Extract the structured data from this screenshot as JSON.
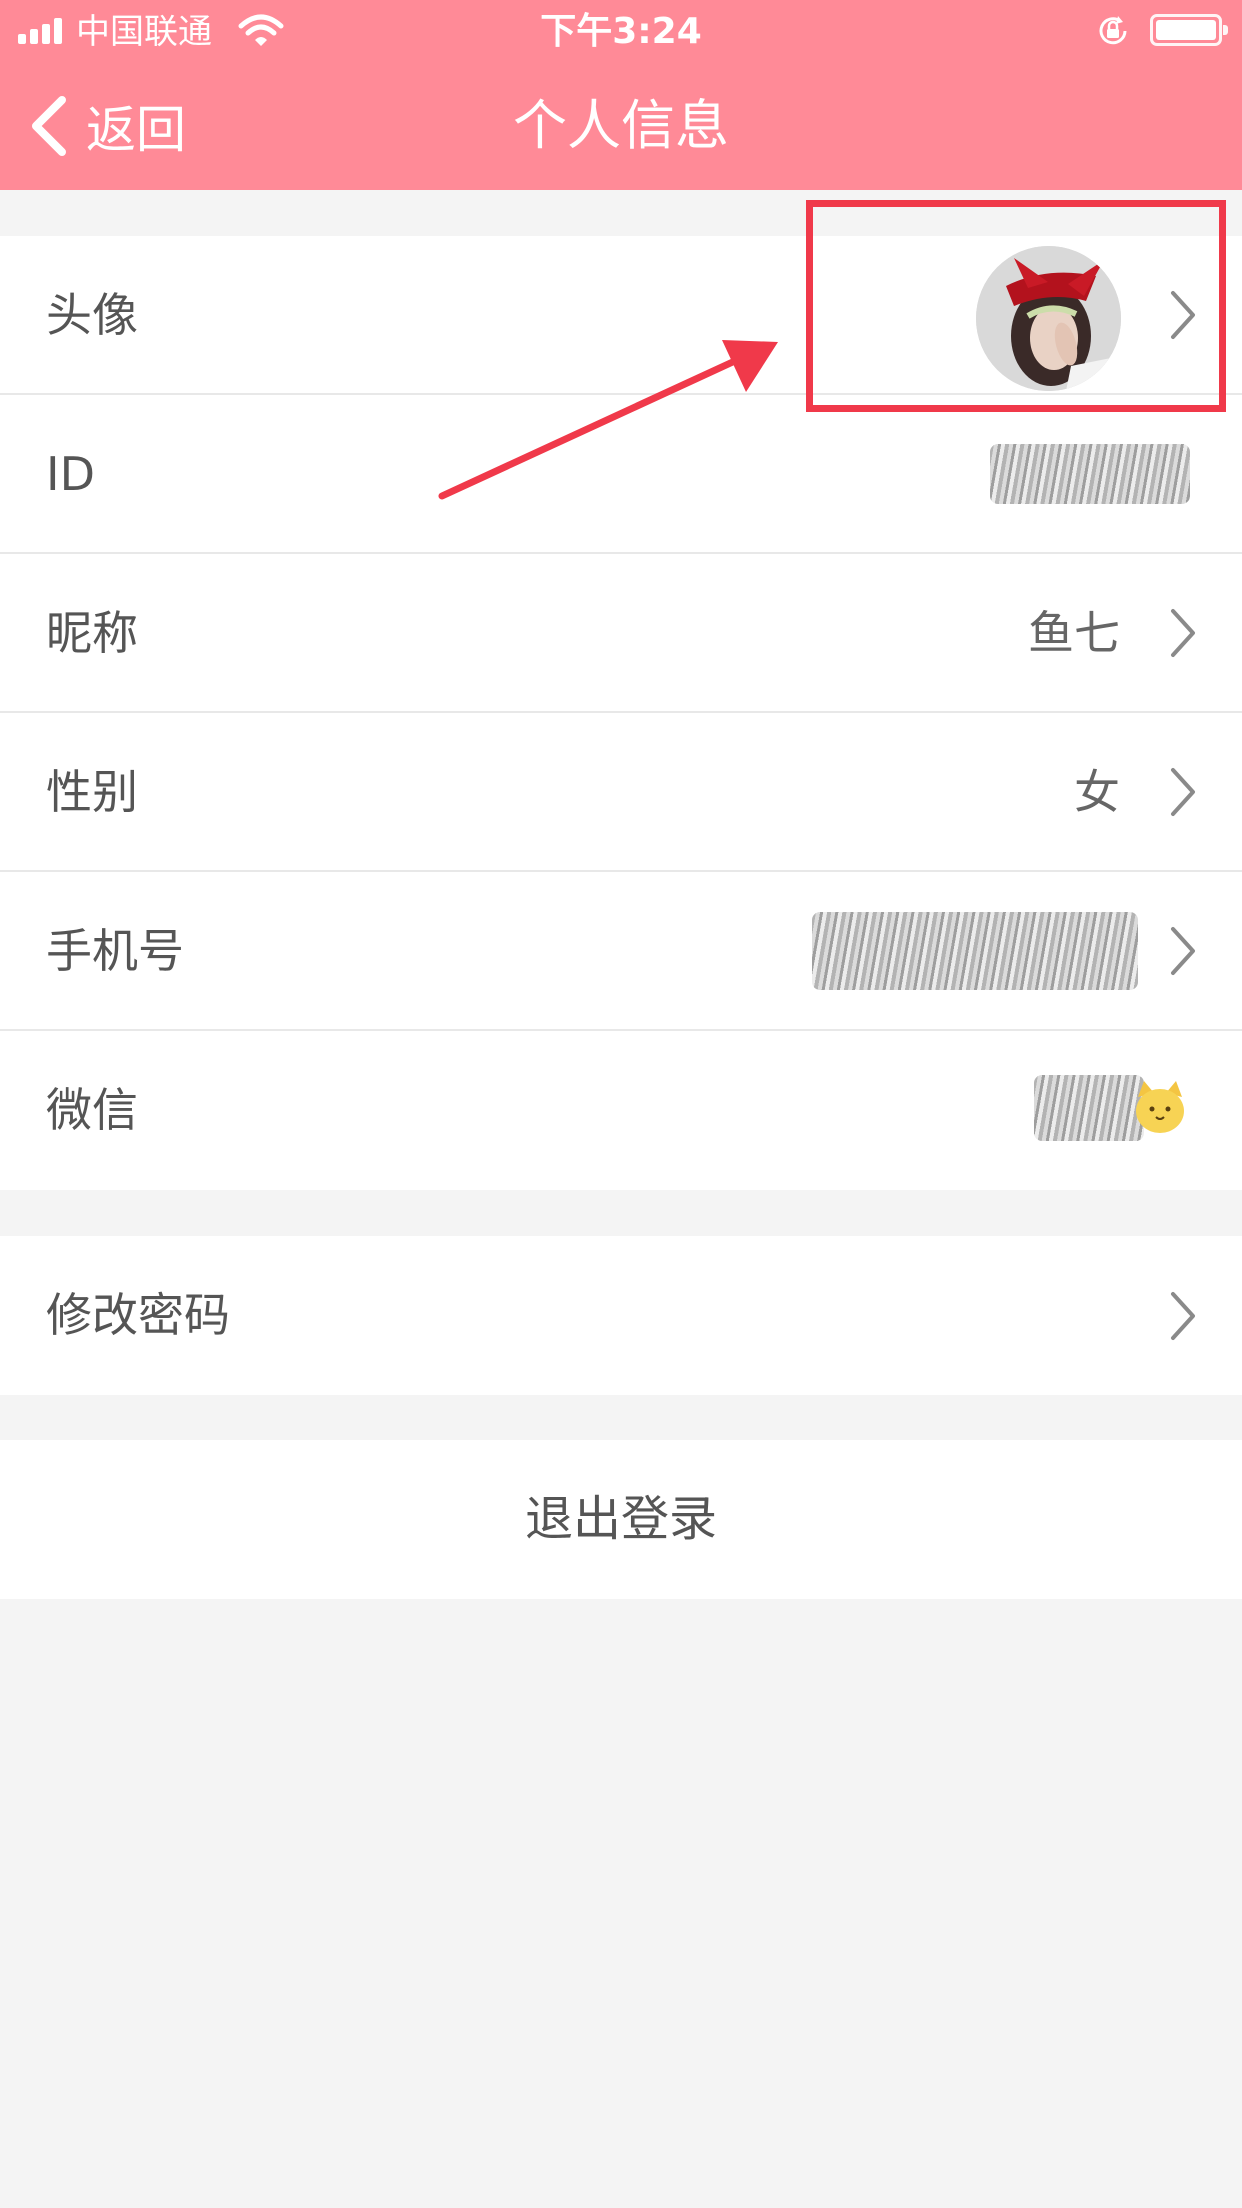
{
  "status_bar": {
    "carrier": "中国联通",
    "time": "下午3:24"
  },
  "nav": {
    "back_label": "返回",
    "title": "个人信息"
  },
  "profile_rows": [
    {
      "label": "头像",
      "value": ""
    },
    {
      "label": "ID",
      "value": ""
    },
    {
      "label": "昵称",
      "value": "鱼七"
    },
    {
      "label": "性别",
      "value": "女"
    },
    {
      "label": "手机号",
      "value": ""
    },
    {
      "label": "微信",
      "value": ""
    }
  ],
  "security": {
    "change_password_label": "修改密码"
  },
  "logout_label": "退出登录",
  "colors": {
    "header": "#ff8a97",
    "highlight": "#f0394a",
    "background": "#f4f4f4"
  }
}
